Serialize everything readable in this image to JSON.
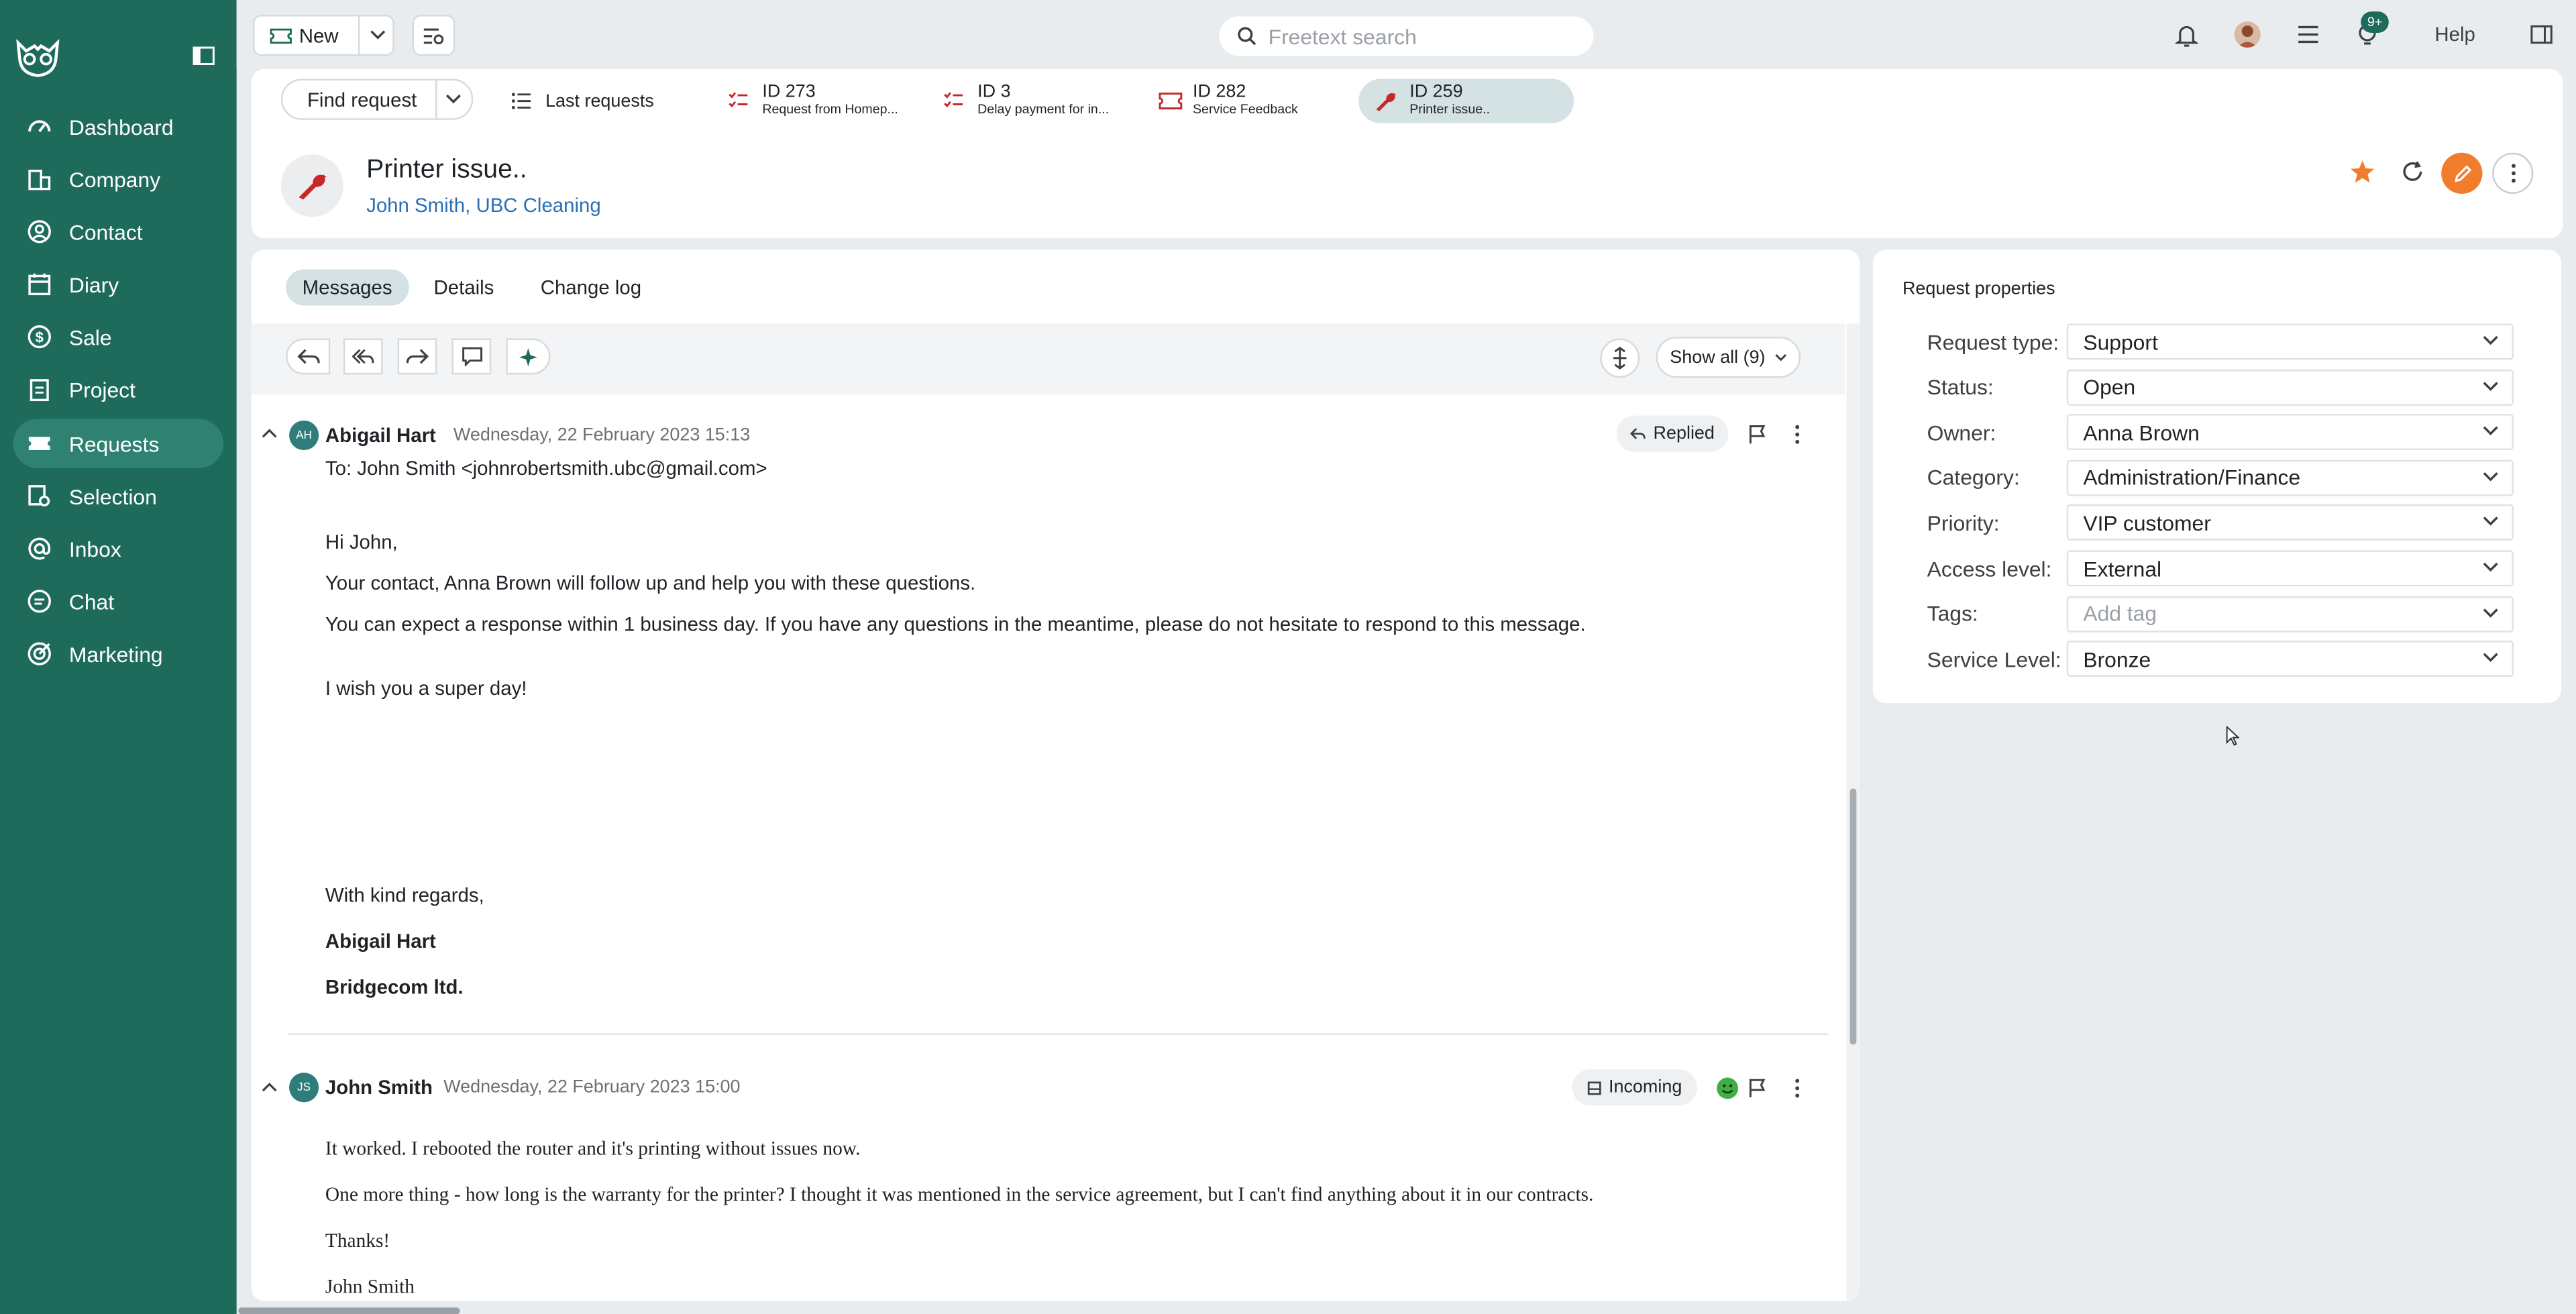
{
  "sidebar": {
    "items": [
      {
        "label": "Dashboard",
        "icon": "dashboard-icon"
      },
      {
        "label": "Company",
        "icon": "building-icon"
      },
      {
        "label": "Contact",
        "icon": "contact-icon"
      },
      {
        "label": "Diary",
        "icon": "calendar-icon"
      },
      {
        "label": "Sale",
        "icon": "dollar-icon"
      },
      {
        "label": "Project",
        "icon": "clipboard-icon"
      },
      {
        "label": "Requests",
        "icon": "ticket-icon"
      },
      {
        "label": "Selection",
        "icon": "selection-icon"
      },
      {
        "label": "Inbox",
        "icon": "at-icon"
      },
      {
        "label": "Chat",
        "icon": "chat-icon"
      },
      {
        "label": "Marketing",
        "icon": "target-icon"
      }
    ],
    "active": "Requests"
  },
  "topbar": {
    "new_label": "New",
    "search_placeholder": "Freetext search",
    "badge": "9+",
    "help_label": "Help"
  },
  "requestbar": {
    "find_label": "Find request",
    "last_requests_label": "Last requests",
    "tabs": [
      {
        "id": "ID 273",
        "sub": "Request from Homep..."
      },
      {
        "id": "ID 3",
        "sub": "Delay payment for in..."
      },
      {
        "id": "ID 282",
        "sub": "Service Feedback"
      },
      {
        "id": "ID 259",
        "sub": "Printer issue.."
      }
    ]
  },
  "request": {
    "title": "Printer issue..",
    "contact": "John Smith",
    "company": "UBC Cleaning"
  },
  "tabs": [
    "Messages",
    "Details",
    "Change log"
  ],
  "toolbar": {
    "show_all": "Show all (9)"
  },
  "messages": [
    {
      "initials": "AH",
      "sender": "Abigail Hart",
      "date": "Wednesday, 22 February 2023 15:13",
      "status": "Replied",
      "to": "To: John Smith <johnrobertsmith.ubc@gmail.com>",
      "lines": [
        "Hi John,",
        "Your contact, Anna Brown will follow up and help you with these questions.",
        "You can expect a response within 1 business day. If you have any questions in the meantime, please do not hesitate to respond to this message.",
        "I wish you a super day!",
        "With kind regards,",
        "Abigail Hart",
        "Bridgecom ltd."
      ]
    },
    {
      "initials": "JS",
      "sender": "John Smith",
      "date": "Wednesday, 22 February 2023 15:00",
      "status": "Incoming",
      "lines": [
        "It worked. I rebooted the router and it's printing without issues now.",
        "One more thing - how long is the warranty for the printer? I thought it was mentioned in the service agreement, but I can't find anything about it in our contracts.",
        "Thanks!",
        "John Smith"
      ]
    }
  ],
  "properties": {
    "title": "Request properties",
    "rows": [
      {
        "label": "Request type:",
        "value": "Support"
      },
      {
        "label": "Status:",
        "value": "Open"
      },
      {
        "label": "Owner:",
        "value": "Anna Brown"
      },
      {
        "label": "Category:",
        "value": "Administration/Finance"
      },
      {
        "label": "Priority:",
        "value": "VIP customer"
      },
      {
        "label": "Access level:",
        "value": "External"
      },
      {
        "label": "Tags:",
        "value": "Add tag"
      },
      {
        "label": "Service Level:",
        "value": "Bronze"
      }
    ]
  },
  "colors": {
    "sidebar": "#1e6b5c",
    "accent_orange": "#f07c2c",
    "request_red": "#c62828",
    "avatar_teal": "#2e7d7a"
  }
}
